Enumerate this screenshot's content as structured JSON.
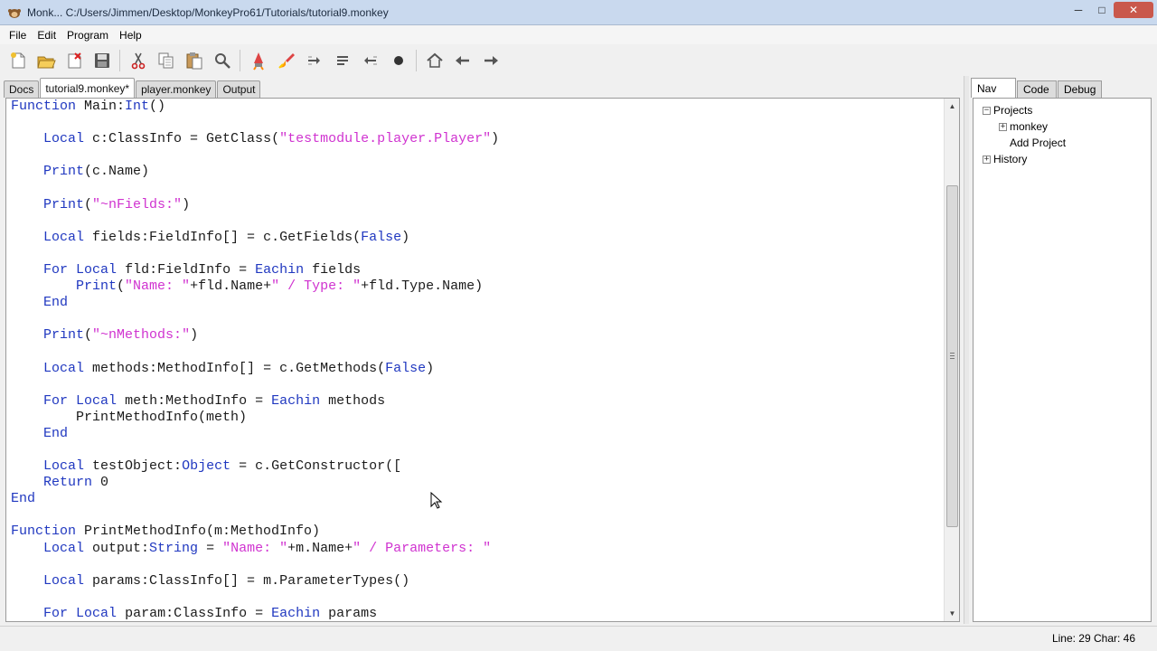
{
  "window": {
    "title": "Monk... C:/Users/Jimmen/Desktop/MonkeyPro61/Tutorials/tutorial9.monkey",
    "controls": [
      "minimize",
      "maximize",
      "close"
    ]
  },
  "menu": [
    "File",
    "Edit",
    "Program",
    "Help"
  ],
  "toolbar": [
    {
      "name": "new-file-icon",
      "title": "New"
    },
    {
      "name": "open-file-icon",
      "title": "Open"
    },
    {
      "name": "close-file-icon",
      "title": "Close"
    },
    {
      "name": "save-icon",
      "title": "Save"
    },
    {
      "name": "cut-icon",
      "title": "Cut"
    },
    {
      "name": "copy-icon",
      "title": "Copy"
    },
    {
      "name": "paste-icon",
      "title": "Paste"
    },
    {
      "name": "find-icon",
      "title": "Find"
    },
    {
      "name": "build-icon",
      "title": "Build"
    },
    {
      "name": "build-run-icon",
      "title": "Build and Run"
    },
    {
      "name": "step-icon",
      "title": "Step"
    },
    {
      "name": "step-in-icon",
      "title": "Step In"
    },
    {
      "name": "step-out-icon",
      "title": "Step Out"
    },
    {
      "name": "kill-icon",
      "title": "Kill"
    },
    {
      "name": "home-icon",
      "title": "Home"
    },
    {
      "name": "back-icon",
      "title": "Back"
    },
    {
      "name": "forward-icon",
      "title": "Forward"
    }
  ],
  "tabs": [
    {
      "label": "Docs",
      "active": false
    },
    {
      "label": "tutorial9.monkey*",
      "active": true
    },
    {
      "label": "player.monkey",
      "active": false
    },
    {
      "label": "Output",
      "active": false
    }
  ],
  "code_lines": [
    [
      [
        "kw",
        "Function"
      ],
      [
        "t",
        " Main:"
      ],
      [
        "kw",
        "Int"
      ],
      [
        "t",
        "()"
      ]
    ],
    [],
    [
      [
        "t",
        "    "
      ],
      [
        "kw",
        "Local"
      ],
      [
        "t",
        " c:ClassInfo = GetClass("
      ],
      [
        "str",
        "\"testmodule.player.Player\""
      ],
      [
        "t",
        ")"
      ]
    ],
    [],
    [
      [
        "t",
        "    "
      ],
      [
        "kw",
        "Print"
      ],
      [
        "t",
        "(c.Name)"
      ]
    ],
    [],
    [
      [
        "t",
        "    "
      ],
      [
        "kw",
        "Print"
      ],
      [
        "t",
        "("
      ],
      [
        "str",
        "\"~nFields:\""
      ],
      [
        "t",
        ")"
      ]
    ],
    [],
    [
      [
        "t",
        "    "
      ],
      [
        "kw",
        "Local"
      ],
      [
        "t",
        " fields:FieldInfo[] = c.GetFields("
      ],
      [
        "kw",
        "False"
      ],
      [
        "t",
        ")"
      ]
    ],
    [],
    [
      [
        "t",
        "    "
      ],
      [
        "kw",
        "For"
      ],
      [
        "t",
        " "
      ],
      [
        "kw",
        "Local"
      ],
      [
        "t",
        " fld:FieldInfo = "
      ],
      [
        "kw",
        "Eachin"
      ],
      [
        "t",
        " fields"
      ]
    ],
    [
      [
        "t",
        "        "
      ],
      [
        "kw",
        "Print"
      ],
      [
        "t",
        "("
      ],
      [
        "str",
        "\"Name: \""
      ],
      [
        "t",
        "+fld.Name+"
      ],
      [
        "str",
        "\" / Type: \""
      ],
      [
        "t",
        "+fld.Type.Name)"
      ]
    ],
    [
      [
        "t",
        "    "
      ],
      [
        "kw",
        "End"
      ]
    ],
    [],
    [
      [
        "t",
        "    "
      ],
      [
        "kw",
        "Print"
      ],
      [
        "t",
        "("
      ],
      [
        "str",
        "\"~nMethods:\""
      ],
      [
        "t",
        ")"
      ]
    ],
    [],
    [
      [
        "t",
        "    "
      ],
      [
        "kw",
        "Local"
      ],
      [
        "t",
        " methods:MethodInfo[] = c.GetMethods("
      ],
      [
        "kw",
        "False"
      ],
      [
        "t",
        ")"
      ]
    ],
    [],
    [
      [
        "t",
        "    "
      ],
      [
        "kw",
        "For"
      ],
      [
        "t",
        " "
      ],
      [
        "kw",
        "Local"
      ],
      [
        "t",
        " meth:MethodInfo = "
      ],
      [
        "kw",
        "Eachin"
      ],
      [
        "t",
        " methods"
      ]
    ],
    [
      [
        "t",
        "        PrintMethodInfo(meth)"
      ]
    ],
    [
      [
        "t",
        "    "
      ],
      [
        "kw",
        "End"
      ]
    ],
    [],
    [
      [
        "t",
        "    "
      ],
      [
        "kw",
        "Local"
      ],
      [
        "t",
        " testObject:"
      ],
      [
        "kw",
        "Object"
      ],
      [
        "t",
        " = c.GetConstructor(["
      ]
    ],
    [
      [
        "t",
        "    "
      ],
      [
        "kw",
        "Return"
      ],
      [
        "t",
        " 0"
      ]
    ],
    [
      [
        "kw",
        "End"
      ]
    ],
    [],
    [
      [
        "kw",
        "Function"
      ],
      [
        "t",
        " PrintMethodInfo(m:MethodInfo)"
      ]
    ],
    [
      [
        "t",
        "    "
      ],
      [
        "kw",
        "Local"
      ],
      [
        "t",
        " output:"
      ],
      [
        "kw",
        "String"
      ],
      [
        "t",
        " = "
      ],
      [
        "str",
        "\"Name: \""
      ],
      [
        "t",
        "+m.Name+"
      ],
      [
        "str",
        "\" / Parameters: \""
      ]
    ],
    [],
    [
      [
        "t",
        "    "
      ],
      [
        "kw",
        "Local"
      ],
      [
        "t",
        " params:ClassInfo[] = m.ParameterTypes()"
      ]
    ],
    [],
    [
      [
        "t",
        "    "
      ],
      [
        "kw",
        "For"
      ],
      [
        "t",
        " "
      ],
      [
        "kw",
        "Local"
      ],
      [
        "t",
        " param:ClassInfo = "
      ],
      [
        "kw",
        "Eachin"
      ],
      [
        "t",
        " params"
      ]
    ]
  ],
  "side_tabs": [
    {
      "label": "Nav",
      "active": true
    },
    {
      "label": "Code",
      "active": false
    },
    {
      "label": "Debug",
      "active": false
    }
  ],
  "tree": {
    "projects": {
      "label": "Projects",
      "expander": "−"
    },
    "monkey": {
      "label": "monkey",
      "expander": "+"
    },
    "add_project": {
      "label": "Add Project"
    },
    "history": {
      "label": "History",
      "expander": "+"
    }
  },
  "status": {
    "position": "Line: 29 Char: 46"
  },
  "colors": {
    "keyword": "#2038c0",
    "string": "#d033d0",
    "text": "#1b1b1b"
  }
}
